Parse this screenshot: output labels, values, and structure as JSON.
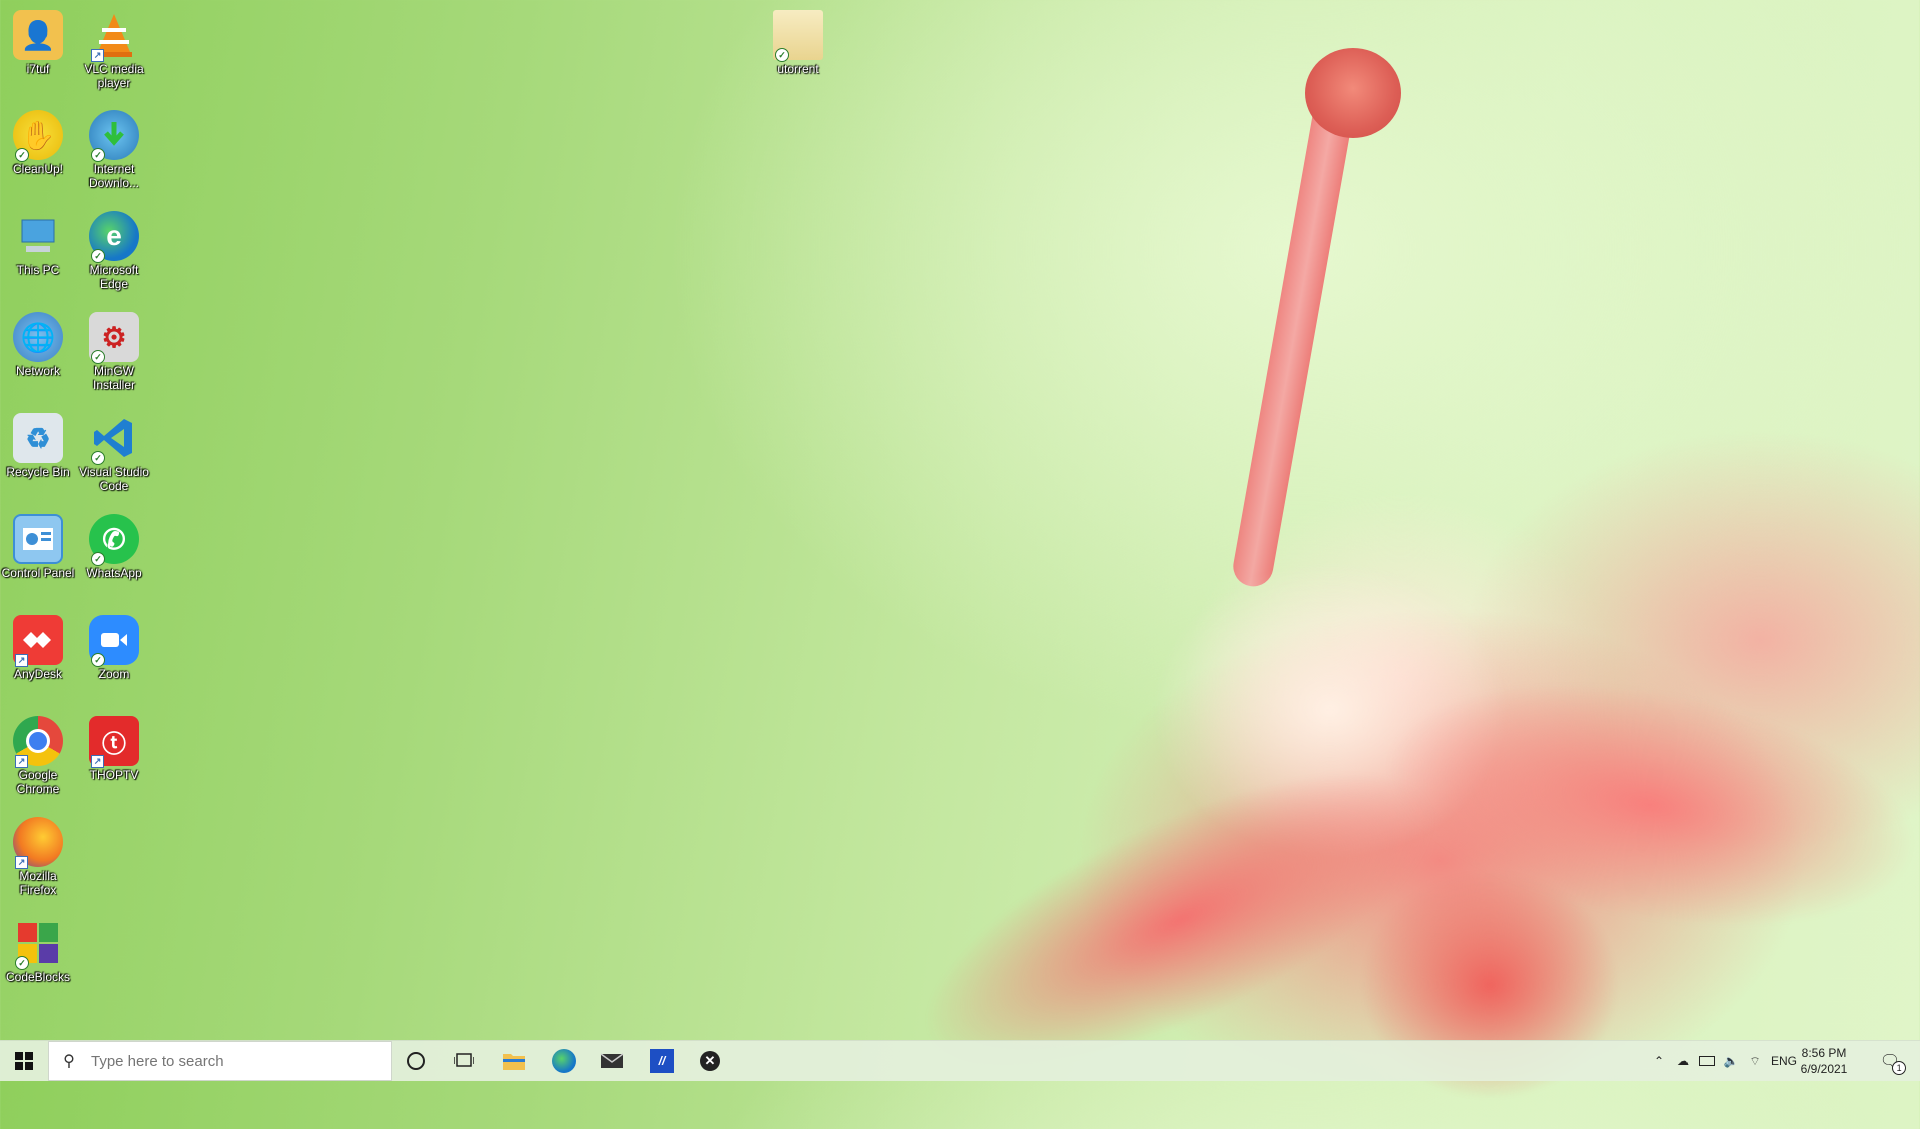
{
  "desktop": {
    "icons": [
      {
        "id": "i7tuf",
        "label": "i7tuf",
        "icon": "user-folder-icon",
        "color": "#f2c14e",
        "badge": "none"
      },
      {
        "id": "vlc",
        "label": "VLC media player",
        "icon": "vlc-icon",
        "color": "#f28a18",
        "badge": "shortcut"
      },
      {
        "id": "cleanup",
        "label": "CleanUp!",
        "icon": "cleanup-icon",
        "color": "#f6d31b",
        "badge": "check"
      },
      {
        "id": "idm",
        "label": "Internet Downlo...",
        "icon": "internet-download-manager-icon",
        "color": "#2a8f3a",
        "badge": "check"
      },
      {
        "id": "thispc",
        "label": "This PC",
        "icon": "computer-icon",
        "color": "#4aa3df",
        "badge": "none"
      },
      {
        "id": "edge",
        "label": "Microsoft Edge",
        "icon": "edge-icon",
        "color": "#1677c8",
        "badge": "check"
      },
      {
        "id": "network",
        "label": "Network",
        "icon": "network-icon",
        "color": "#3b82c4",
        "badge": "none"
      },
      {
        "id": "mingw",
        "label": "MinGW Installer",
        "icon": "mingw-installer-icon",
        "color": "#8a8a8a",
        "badge": "check"
      },
      {
        "id": "recycle",
        "label": "Recycle Bin",
        "icon": "recycle-bin-icon",
        "color": "#c9d5dc",
        "badge": "none"
      },
      {
        "id": "vscode",
        "label": "Visual Studio Code",
        "icon": "vscode-icon",
        "color": "#1f7fd1",
        "badge": "check"
      },
      {
        "id": "controlpanel",
        "label": "Control Panel",
        "icon": "control-panel-icon",
        "color": "#3d8fd6",
        "badge": "none"
      },
      {
        "id": "whatsapp",
        "label": "WhatsApp",
        "icon": "whatsapp-icon",
        "color": "#27c24c",
        "badge": "check"
      },
      {
        "id": "anydesk",
        "label": "AnyDesk",
        "icon": "anydesk-icon",
        "color": "#ef3b36",
        "badge": "shortcut"
      },
      {
        "id": "zoom",
        "label": "Zoom",
        "icon": "zoom-icon",
        "color": "#2d8cff",
        "badge": "check"
      },
      {
        "id": "chrome",
        "label": "Google Chrome",
        "icon": "chrome-icon",
        "color": "#e5483c",
        "badge": "shortcut"
      },
      {
        "id": "thoptv",
        "label": "THOPTV",
        "icon": "thoptv-icon",
        "color": "#e32b2b",
        "badge": "shortcut"
      },
      {
        "id": "firefox",
        "label": "Mozilla Firefox",
        "icon": "firefox-icon",
        "color": "#f27a22",
        "badge": "shortcut"
      },
      {
        "id": "codeblocks",
        "label": "CodeBlocks",
        "icon": "codeblocks-icon",
        "color": "#3aa64a",
        "badge": "check"
      },
      {
        "id": "utorrent",
        "label": "utorrent",
        "icon": "folder-icon",
        "color": "#f2e4b0",
        "badge": "check"
      }
    ]
  },
  "taskbar": {
    "search_placeholder": "Type here to search",
    "pinned": [
      {
        "name": "cortana-icon"
      },
      {
        "name": "task-view-icon"
      },
      {
        "name": "file-explorer-icon"
      },
      {
        "name": "edge-icon"
      },
      {
        "name": "mail-icon"
      },
      {
        "name": "app-icon"
      },
      {
        "name": "xbox-icon"
      }
    ],
    "tray": {
      "language": "ENG",
      "time": "8:56 PM",
      "date": "6/9/2021",
      "notification_count": "1"
    }
  }
}
